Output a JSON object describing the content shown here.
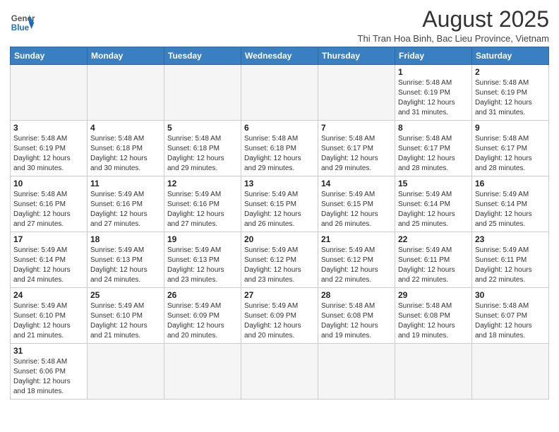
{
  "header": {
    "logo_general": "General",
    "logo_blue": "Blue",
    "month_title": "August 2025",
    "subtitle": "Thi Tran Hoa Binh, Bac Lieu Province, Vietnam"
  },
  "days_of_week": [
    "Sunday",
    "Monday",
    "Tuesday",
    "Wednesday",
    "Thursday",
    "Friday",
    "Saturday"
  ],
  "weeks": [
    [
      {
        "day": "",
        "info": ""
      },
      {
        "day": "",
        "info": ""
      },
      {
        "day": "",
        "info": ""
      },
      {
        "day": "",
        "info": ""
      },
      {
        "day": "",
        "info": ""
      },
      {
        "day": "1",
        "info": "Sunrise: 5:48 AM\nSunset: 6:19 PM\nDaylight: 12 hours\nand 31 minutes."
      },
      {
        "day": "2",
        "info": "Sunrise: 5:48 AM\nSunset: 6:19 PM\nDaylight: 12 hours\nand 31 minutes."
      }
    ],
    [
      {
        "day": "3",
        "info": "Sunrise: 5:48 AM\nSunset: 6:19 PM\nDaylight: 12 hours\nand 30 minutes."
      },
      {
        "day": "4",
        "info": "Sunrise: 5:48 AM\nSunset: 6:18 PM\nDaylight: 12 hours\nand 30 minutes."
      },
      {
        "day": "5",
        "info": "Sunrise: 5:48 AM\nSunset: 6:18 PM\nDaylight: 12 hours\nand 29 minutes."
      },
      {
        "day": "6",
        "info": "Sunrise: 5:48 AM\nSunset: 6:18 PM\nDaylight: 12 hours\nand 29 minutes."
      },
      {
        "day": "7",
        "info": "Sunrise: 5:48 AM\nSunset: 6:17 PM\nDaylight: 12 hours\nand 29 minutes."
      },
      {
        "day": "8",
        "info": "Sunrise: 5:48 AM\nSunset: 6:17 PM\nDaylight: 12 hours\nand 28 minutes."
      },
      {
        "day": "9",
        "info": "Sunrise: 5:48 AM\nSunset: 6:17 PM\nDaylight: 12 hours\nand 28 minutes."
      }
    ],
    [
      {
        "day": "10",
        "info": "Sunrise: 5:48 AM\nSunset: 6:16 PM\nDaylight: 12 hours\nand 27 minutes."
      },
      {
        "day": "11",
        "info": "Sunrise: 5:49 AM\nSunset: 6:16 PM\nDaylight: 12 hours\nand 27 minutes."
      },
      {
        "day": "12",
        "info": "Sunrise: 5:49 AM\nSunset: 6:16 PM\nDaylight: 12 hours\nand 27 minutes."
      },
      {
        "day": "13",
        "info": "Sunrise: 5:49 AM\nSunset: 6:15 PM\nDaylight: 12 hours\nand 26 minutes."
      },
      {
        "day": "14",
        "info": "Sunrise: 5:49 AM\nSunset: 6:15 PM\nDaylight: 12 hours\nand 26 minutes."
      },
      {
        "day": "15",
        "info": "Sunrise: 5:49 AM\nSunset: 6:14 PM\nDaylight: 12 hours\nand 25 minutes."
      },
      {
        "day": "16",
        "info": "Sunrise: 5:49 AM\nSunset: 6:14 PM\nDaylight: 12 hours\nand 25 minutes."
      }
    ],
    [
      {
        "day": "17",
        "info": "Sunrise: 5:49 AM\nSunset: 6:14 PM\nDaylight: 12 hours\nand 24 minutes."
      },
      {
        "day": "18",
        "info": "Sunrise: 5:49 AM\nSunset: 6:13 PM\nDaylight: 12 hours\nand 24 minutes."
      },
      {
        "day": "19",
        "info": "Sunrise: 5:49 AM\nSunset: 6:13 PM\nDaylight: 12 hours\nand 23 minutes."
      },
      {
        "day": "20",
        "info": "Sunrise: 5:49 AM\nSunset: 6:12 PM\nDaylight: 12 hours\nand 23 minutes."
      },
      {
        "day": "21",
        "info": "Sunrise: 5:49 AM\nSunset: 6:12 PM\nDaylight: 12 hours\nand 22 minutes."
      },
      {
        "day": "22",
        "info": "Sunrise: 5:49 AM\nSunset: 6:11 PM\nDaylight: 12 hours\nand 22 minutes."
      },
      {
        "day": "23",
        "info": "Sunrise: 5:49 AM\nSunset: 6:11 PM\nDaylight: 12 hours\nand 22 minutes."
      }
    ],
    [
      {
        "day": "24",
        "info": "Sunrise: 5:49 AM\nSunset: 6:10 PM\nDaylight: 12 hours\nand 21 minutes."
      },
      {
        "day": "25",
        "info": "Sunrise: 5:49 AM\nSunset: 6:10 PM\nDaylight: 12 hours\nand 21 minutes."
      },
      {
        "day": "26",
        "info": "Sunrise: 5:49 AM\nSunset: 6:09 PM\nDaylight: 12 hours\nand 20 minutes."
      },
      {
        "day": "27",
        "info": "Sunrise: 5:49 AM\nSunset: 6:09 PM\nDaylight: 12 hours\nand 20 minutes."
      },
      {
        "day": "28",
        "info": "Sunrise: 5:48 AM\nSunset: 6:08 PM\nDaylight: 12 hours\nand 19 minutes."
      },
      {
        "day": "29",
        "info": "Sunrise: 5:48 AM\nSunset: 6:08 PM\nDaylight: 12 hours\nand 19 minutes."
      },
      {
        "day": "30",
        "info": "Sunrise: 5:48 AM\nSunset: 6:07 PM\nDaylight: 12 hours\nand 18 minutes."
      }
    ],
    [
      {
        "day": "31",
        "info": "Sunrise: 5:48 AM\nSunset: 6:06 PM\nDaylight: 12 hours\nand 18 minutes."
      },
      {
        "day": "",
        "info": ""
      },
      {
        "day": "",
        "info": ""
      },
      {
        "day": "",
        "info": ""
      },
      {
        "day": "",
        "info": ""
      },
      {
        "day": "",
        "info": ""
      },
      {
        "day": "",
        "info": ""
      }
    ]
  ]
}
